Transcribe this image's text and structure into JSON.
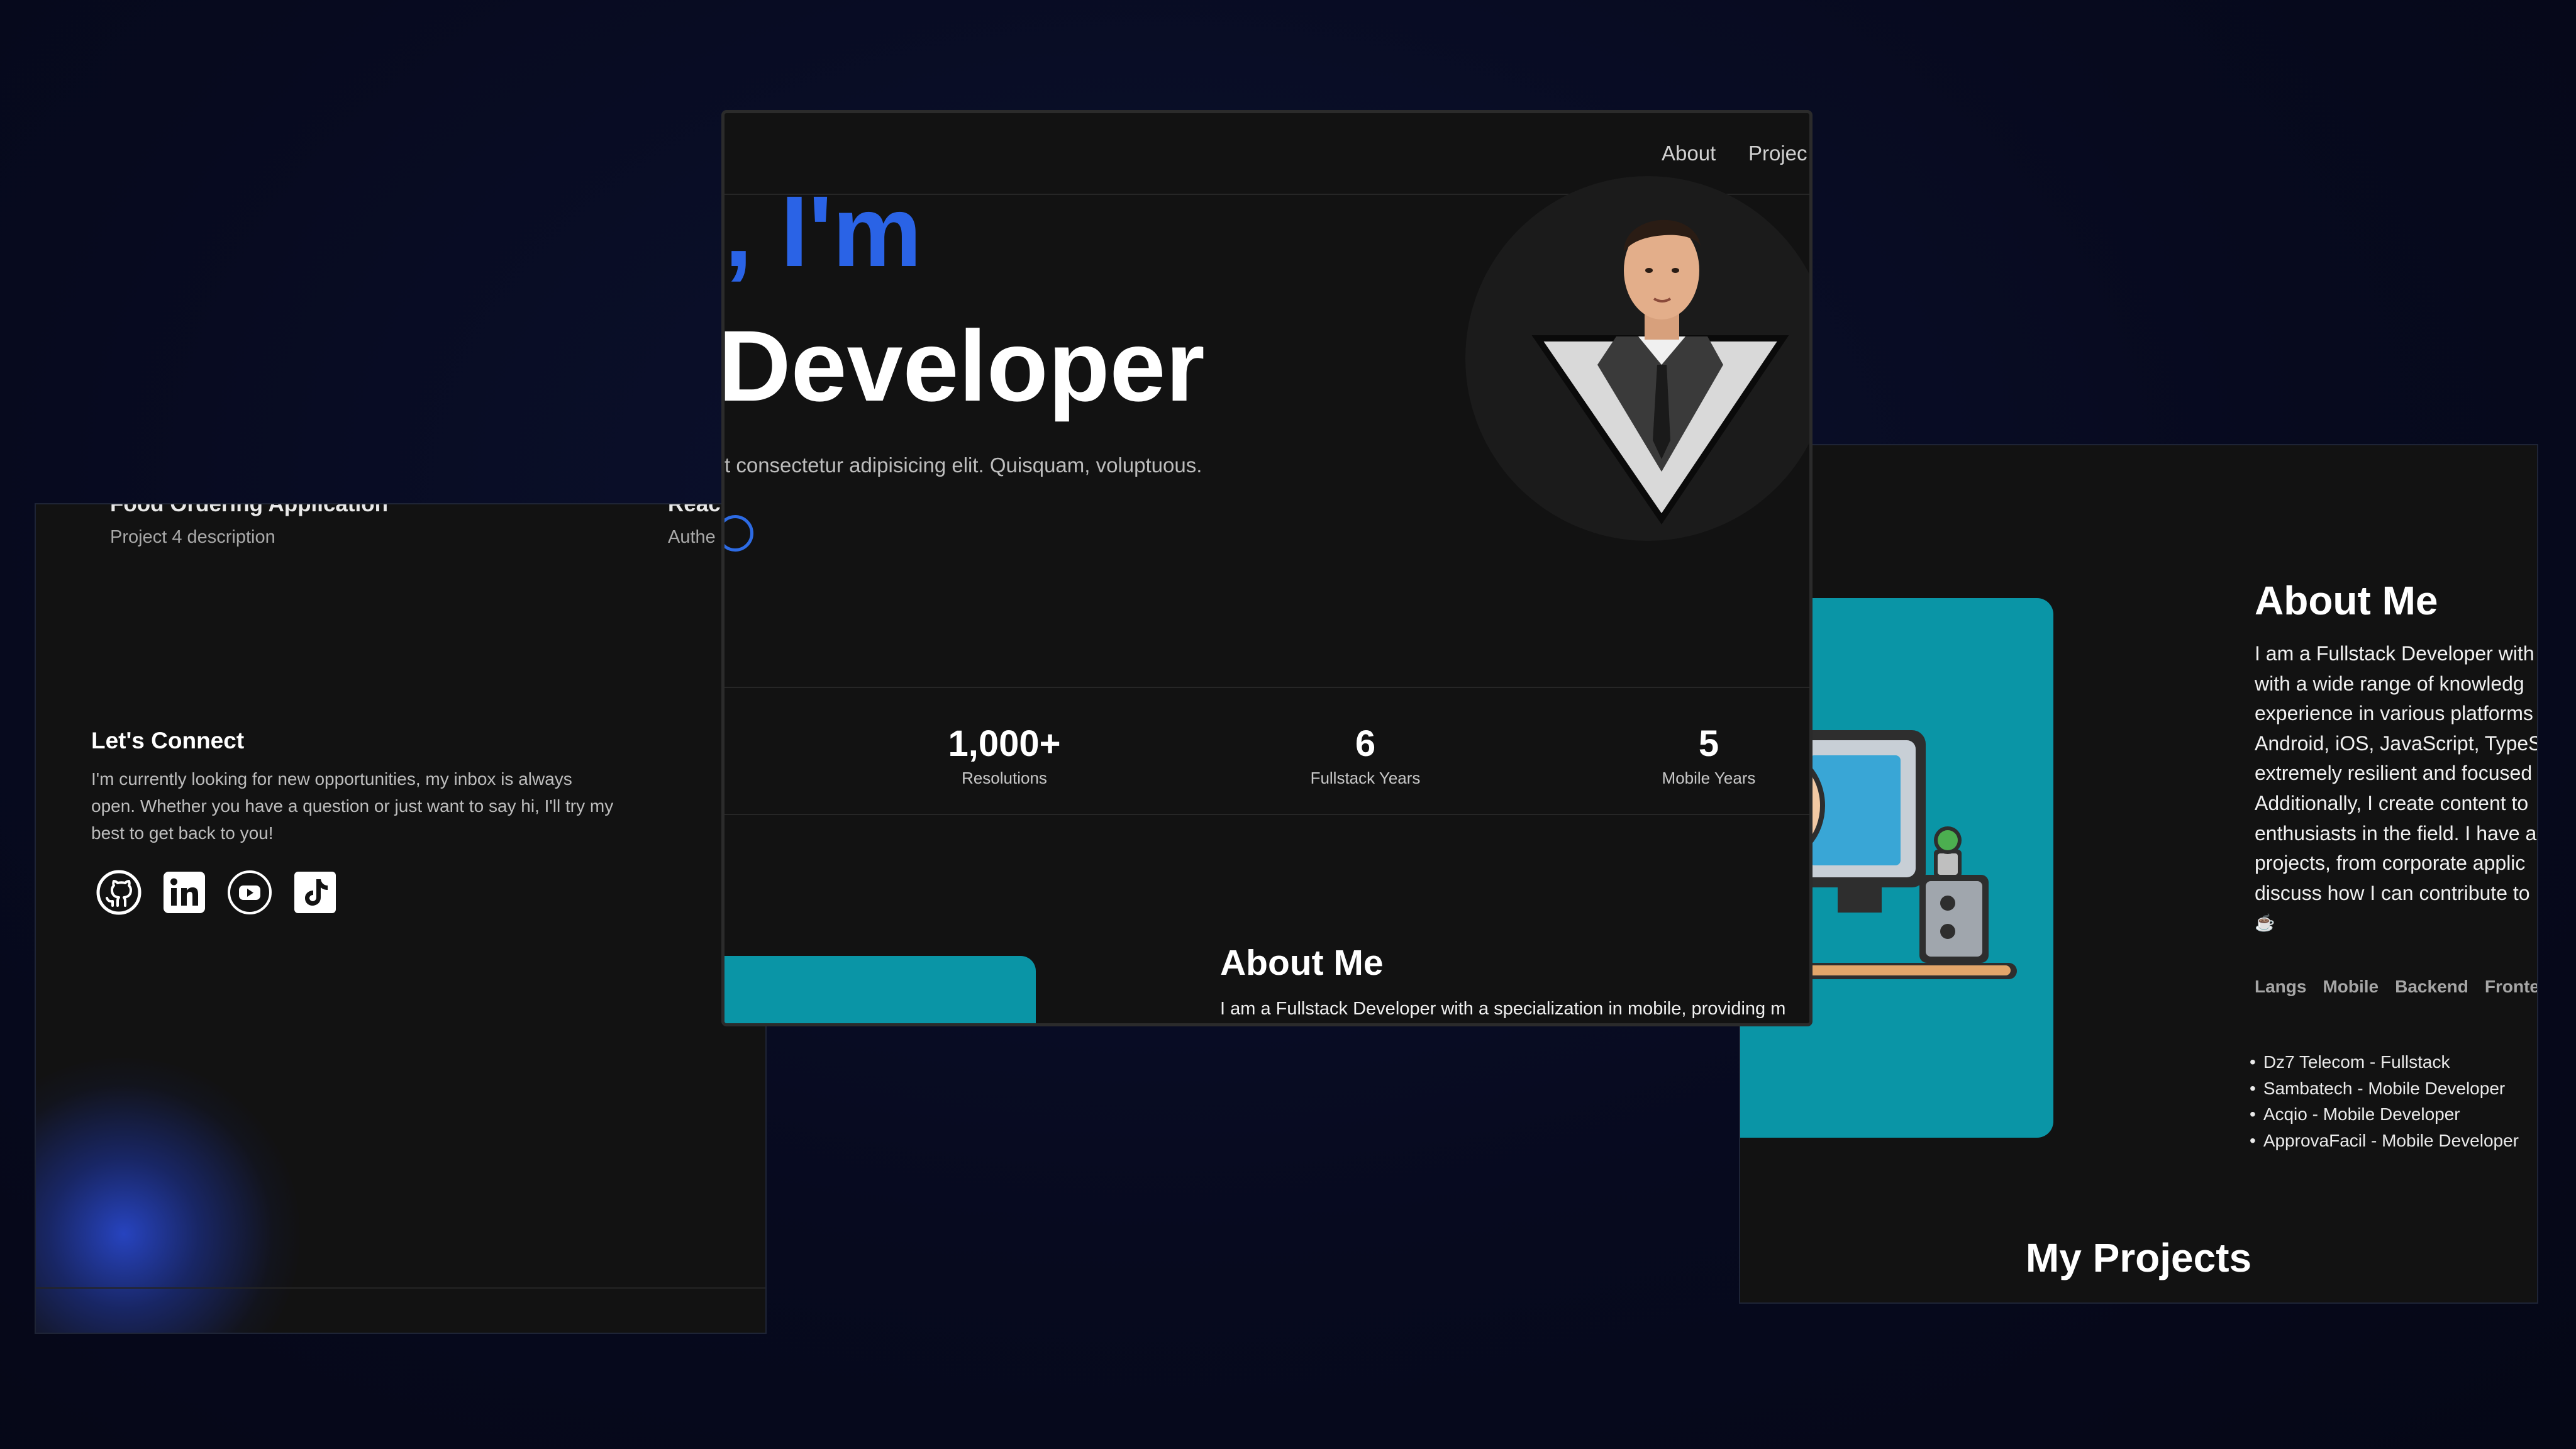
{
  "left_panel": {
    "project_title_left": "Food Ordering Application",
    "project_desc_left": "Project 4 description",
    "project_title_right": "React",
    "project_desc_right": "Authe",
    "connect_title": "Let's Connect",
    "connect_text": "I'm currently looking for new opportunities, my inbox is always open. Whether you have a question or just want to say hi, I'll try my best to get back to you!",
    "socials": [
      "github-icon",
      "linkedin-icon",
      "youtube-icon",
      "tiktok-icon"
    ]
  },
  "center_panel": {
    "nav": {
      "about": "About",
      "projects": "Projec"
    },
    "hero": {
      "greeting": ", I'm",
      "role": "Developer",
      "subtitle": "t consectetur adipisicing elit. Quisquam, voluptuous."
    },
    "stats": [
      {
        "value": "1,000+",
        "label": "Resolutions"
      },
      {
        "value": "6",
        "label": "Fullstack Years"
      },
      {
        "value": "5",
        "label": "Mobile Years"
      }
    ],
    "about_title": "About Me",
    "about_text": "I am a Fullstack Developer with a specialization in mobile, providing m"
  },
  "right_panel": {
    "about_title": "About Me",
    "about_lines": [
      "I am a Fullstack Developer with",
      "with a wide range of knowledg",
      "experience in various platforms",
      "Android, iOS, JavaScript, TypeS",
      "extremely resilient and focused",
      "Additionally, I create content to",
      "enthusiasts in the field. I have a",
      "projects, from corporate applic",
      "discuss how I can contribute to",
      "☕"
    ],
    "tabs": [
      "Langs",
      "Mobile",
      "Backend",
      "Fronten"
    ],
    "jobs": [
      "Dz7 Telecom - Fullstack",
      "Sambatech - Mobile Developer",
      "Acqio - Mobile Developer",
      "ApprovaFacil - Mobile Developer"
    ],
    "projects_title": "My Projects"
  },
  "colors": {
    "background": "#070a1f",
    "panel": "#121212",
    "accent_blue": "#2a63e6",
    "teal": "#0a95a6"
  }
}
